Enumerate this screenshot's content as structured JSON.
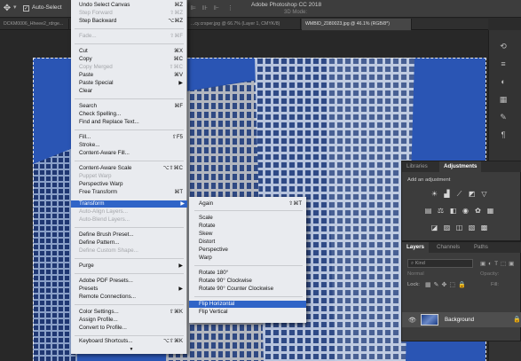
{
  "app": {
    "title": "Adobe Photoshop CC 2018",
    "auto_select_label": "Auto-Select",
    "mode_3d_label": "3D Mode:"
  },
  "doc_tabs": [
    "DCKM0006_Hheee2_rdrge...",
    "...cy.crsper.jpg @ 66.7% (Layer 1, CMYK/8)",
    "WMBID_Z080023.jpg @ 46.1% (RGB/8*)"
  ],
  "edit_menu": {
    "items": [
      {
        "label": "Undo Select Canvas",
        "shortcut": "⌘Z",
        "enabled": true
      },
      {
        "label": "Step Forward",
        "shortcut": "⇧⌘Z",
        "enabled": false
      },
      {
        "label": "Step Backward",
        "shortcut": "⌥⌘Z",
        "enabled": true
      },
      {
        "label": "Fade...",
        "shortcut": "⇧⌘F",
        "enabled": false
      },
      {
        "label": "Cut",
        "shortcut": "⌘X",
        "enabled": true
      },
      {
        "label": "Copy",
        "shortcut": "⌘C",
        "enabled": true
      },
      {
        "label": "Copy Merged",
        "shortcut": "⇧⌘C",
        "enabled": false
      },
      {
        "label": "Paste",
        "shortcut": "⌘V",
        "enabled": true
      },
      {
        "label": "Paste Special",
        "submenu": true,
        "enabled": true
      },
      {
        "label": "Clear",
        "enabled": true
      },
      {
        "label": "Search",
        "shortcut": "⌘F",
        "enabled": true
      },
      {
        "label": "Check Spelling...",
        "enabled": true
      },
      {
        "label": "Find and Replace Text...",
        "enabled": true
      },
      {
        "label": "Fill...",
        "shortcut": "⇧F5",
        "enabled": true
      },
      {
        "label": "Stroke...",
        "enabled": true
      },
      {
        "label": "Content-Aware Fill...",
        "enabled": true
      },
      {
        "label": "Content-Aware Scale",
        "shortcut": "⌥⇧⌘C",
        "enabled": true
      },
      {
        "label": "Puppet Warp",
        "enabled": false
      },
      {
        "label": "Perspective Warp",
        "enabled": true
      },
      {
        "label": "Free Transform",
        "shortcut": "⌘T",
        "enabled": true
      },
      {
        "label": "Transform",
        "submenu": true,
        "enabled": true,
        "highlighted": true
      },
      {
        "label": "Auto-Align Layers...",
        "enabled": false
      },
      {
        "label": "Auto-Blend Layers...",
        "enabled": false
      },
      {
        "label": "Define Brush Preset...",
        "enabled": true
      },
      {
        "label": "Define Pattern...",
        "enabled": true
      },
      {
        "label": "Define Custom Shape...",
        "enabled": false
      },
      {
        "label": "Purge",
        "submenu": true,
        "enabled": true
      },
      {
        "label": "Adobe PDF Presets...",
        "enabled": true
      },
      {
        "label": "Presets",
        "submenu": true,
        "enabled": true
      },
      {
        "label": "Remote Connections...",
        "enabled": true
      },
      {
        "label": "Color Settings...",
        "shortcut": "⇧⌘K",
        "enabled": true
      },
      {
        "label": "Assign Profile...",
        "enabled": true
      },
      {
        "label": "Convert to Profile...",
        "enabled": true
      },
      {
        "label": "Keyboard Shortcuts...",
        "shortcut": "⌥⇧⌘K",
        "enabled": true
      }
    ],
    "more_indicator": "▼"
  },
  "transform_menu": {
    "items": [
      {
        "label": "Again",
        "shortcut": "⇧⌘T"
      },
      {
        "label": "Scale"
      },
      {
        "label": "Rotate"
      },
      {
        "label": "Skew"
      },
      {
        "label": "Distort"
      },
      {
        "label": "Perspective"
      },
      {
        "label": "Warp"
      },
      {
        "label": "Rotate 180°"
      },
      {
        "label": "Rotate 90° Clockwise"
      },
      {
        "label": "Rotate 90° Counter Clockwise"
      },
      {
        "label": "Flip Horizontal",
        "highlighted": true
      },
      {
        "label": "Flip Vertical"
      }
    ]
  },
  "adjustments_panel": {
    "tabs": [
      "Libraries",
      "Adjustments"
    ],
    "active_tab": "Adjustments",
    "heading": "Add an adjustment",
    "icons": [
      "brightness-icon",
      "levels-icon",
      "curves-icon",
      "exposure-icon",
      "vibrance-icon",
      "hue-saturation-icon",
      "color-balance-icon",
      "black-white-icon",
      "photo-filter-icon",
      "channel-mixer-icon",
      "color-lookup-icon",
      "invert-icon",
      "posterize-icon",
      "threshold-icon",
      "gradient-map-icon",
      "selective-color-icon"
    ]
  },
  "layers_panel": {
    "tabs": [
      "Layers",
      "Channels",
      "Paths"
    ],
    "active_tab": "Layers",
    "filter_label": "Kind",
    "blend_mode": "Normal",
    "opacity_label": "Opacity:",
    "lock_label": "Lock:",
    "fill_label": "Fill:",
    "layers": [
      {
        "name": "Background",
        "visible": true,
        "locked": true
      }
    ]
  },
  "colors": {
    "menu_bg": "#e9ebef",
    "menu_highlight": "#2f64c7",
    "panel_bg": "#3c3c3c",
    "app_bg": "#2b2b2b"
  }
}
